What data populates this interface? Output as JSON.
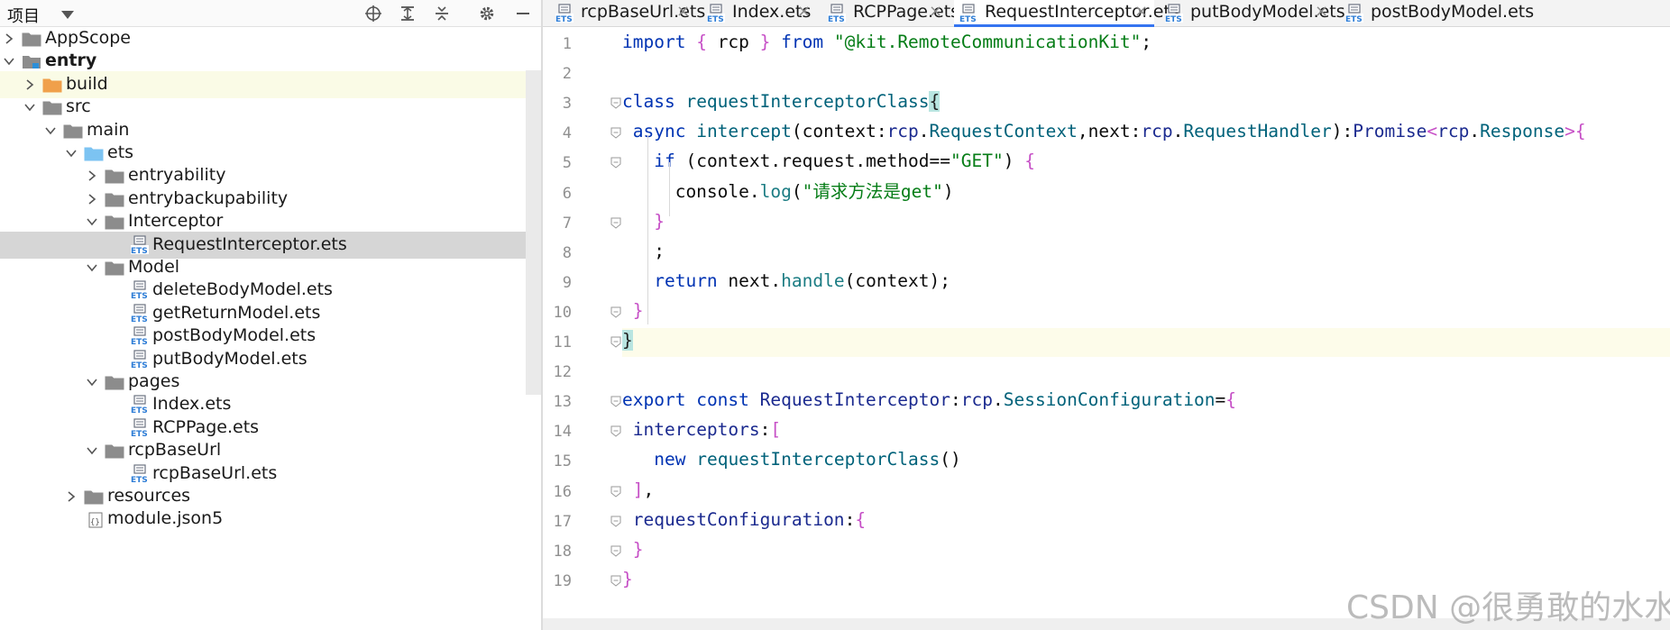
{
  "project_panel": {
    "title": "项目",
    "toolbar_icons": [
      "locate-icon",
      "expand-all-icon",
      "collapse-all-icon",
      "settings-icon",
      "minimize-icon"
    ],
    "tree": [
      {
        "label": "AppScope",
        "type": "folder",
        "depth": 0,
        "expanded": false
      },
      {
        "label": "entry",
        "type": "module",
        "depth": 0,
        "expanded": true,
        "bold": true
      },
      {
        "label": "build",
        "type": "folder-orange",
        "depth": 1,
        "expanded": false,
        "highlight": true
      },
      {
        "label": "src",
        "type": "folder",
        "depth": 1,
        "expanded": true
      },
      {
        "label": "main",
        "type": "folder",
        "depth": 2,
        "expanded": true
      },
      {
        "label": "ets",
        "type": "folder-blue",
        "depth": 3,
        "expanded": true
      },
      {
        "label": "entryability",
        "type": "folder",
        "depth": 4,
        "expanded": false
      },
      {
        "label": "entrybackupability",
        "type": "folder",
        "depth": 4,
        "expanded": false
      },
      {
        "label": "Interceptor",
        "type": "folder",
        "depth": 4,
        "expanded": true
      },
      {
        "label": "RequestInterceptor.ets",
        "type": "ets",
        "depth": 5,
        "selected": true
      },
      {
        "label": "Model",
        "type": "folder",
        "depth": 4,
        "expanded": true
      },
      {
        "label": "deleteBodyModel.ets",
        "type": "ets",
        "depth": 5
      },
      {
        "label": "getReturnModel.ets",
        "type": "ets",
        "depth": 5
      },
      {
        "label": "postBodyModel.ets",
        "type": "ets",
        "depth": 5
      },
      {
        "label": "putBodyModel.ets",
        "type": "ets",
        "depth": 5
      },
      {
        "label": "pages",
        "type": "folder",
        "depth": 4,
        "expanded": true
      },
      {
        "label": "Index.ets",
        "type": "ets",
        "depth": 5
      },
      {
        "label": "RCPPage.ets",
        "type": "ets",
        "depth": 5
      },
      {
        "label": "rcpBaseUrl",
        "type": "folder",
        "depth": 4,
        "expanded": true
      },
      {
        "label": "rcpBaseUrl.ets",
        "type": "ets",
        "depth": 5
      },
      {
        "label": "resources",
        "type": "folder",
        "depth": 3,
        "expanded": false
      },
      {
        "label": "module.json5",
        "type": "json",
        "depth": 3
      }
    ]
  },
  "editor": {
    "tabs": [
      {
        "label": "rcpBaseUrl.ets",
        "active": false
      },
      {
        "label": "Index.ets",
        "active": false
      },
      {
        "label": "RCPPage.ets",
        "active": false
      },
      {
        "label": "RequestInterceptor.ets",
        "active": true
      },
      {
        "label": "putBodyModel.ets",
        "active": false
      },
      {
        "label": "postBodyModel.ets",
        "active": false
      }
    ],
    "tab_close_glyph": "×",
    "current_line": 11,
    "lines": [
      {
        "no": "1",
        "tokens": [
          [
            "kw",
            "import"
          ],
          [
            "pl",
            " "
          ],
          [
            "br",
            "{"
          ],
          [
            "pl",
            " rcp "
          ],
          [
            "br",
            "}"
          ],
          [
            "pl",
            " "
          ],
          [
            "kw",
            "from"
          ],
          [
            "pl",
            " "
          ],
          [
            "str",
            "\"@kit.RemoteCommunicationKit\""
          ],
          [
            "pl",
            ";"
          ]
        ]
      },
      {
        "no": "2",
        "tokens": []
      },
      {
        "no": "3",
        "tokens": [
          [
            "kw",
            "class"
          ],
          [
            "pl",
            " "
          ],
          [
            "fn",
            "requestInterceptorClass"
          ],
          [
            "hlbr",
            "{"
          ]
        ]
      },
      {
        "no": "4",
        "tokens": [
          [
            "pl",
            " "
          ],
          [
            "kw",
            "async"
          ],
          [
            "pl",
            " "
          ],
          [
            "fn",
            "intercept"
          ],
          [
            "pl",
            "("
          ],
          [
            "pl",
            "context"
          ],
          [
            "pl",
            ":"
          ],
          [
            "id",
            "rcp"
          ],
          [
            "pl",
            "."
          ],
          [
            "fn",
            "RequestContext"
          ],
          [
            "pl",
            ","
          ],
          [
            "pl",
            "next"
          ],
          [
            "pl",
            ":"
          ],
          [
            "id",
            "rcp"
          ],
          [
            "pl",
            "."
          ],
          [
            "fn",
            "RequestHandler"
          ],
          [
            "pl",
            "):"
          ],
          [
            "id",
            "Promise"
          ],
          [
            "pn",
            "<"
          ],
          [
            "id",
            "rcp"
          ],
          [
            "pl",
            "."
          ],
          [
            "fn",
            "Response"
          ],
          [
            "pn",
            ">"
          ],
          [
            "br",
            "{"
          ]
        ]
      },
      {
        "no": "5",
        "tokens": [
          [
            "pl",
            "   "
          ],
          [
            "kw",
            "if"
          ],
          [
            "pl",
            " ("
          ],
          [
            "pl",
            "context"
          ],
          [
            "pl",
            "."
          ],
          [
            "pl",
            "request"
          ],
          [
            "pl",
            "."
          ],
          [
            "pl",
            "method"
          ],
          [
            "pl",
            "=="
          ],
          [
            "str",
            "\"GET\""
          ],
          [
            "pl",
            ") "
          ],
          [
            "br",
            "{"
          ]
        ]
      },
      {
        "no": "6",
        "tokens": [
          [
            "pl",
            "     console"
          ],
          [
            "pl",
            "."
          ],
          [
            "mth",
            "log"
          ],
          [
            "pl",
            "("
          ],
          [
            "str",
            "\"请求方法是get\""
          ],
          [
            "pl",
            ")"
          ]
        ]
      },
      {
        "no": "7",
        "tokens": [
          [
            "pl",
            "   "
          ],
          [
            "br",
            "}"
          ]
        ]
      },
      {
        "no": "8",
        "tokens": [
          [
            "pl",
            "   ;"
          ]
        ]
      },
      {
        "no": "9",
        "tokens": [
          [
            "pl",
            "   "
          ],
          [
            "kw",
            "return"
          ],
          [
            "pl",
            " next"
          ],
          [
            "pl",
            "."
          ],
          [
            "mth",
            "handle"
          ],
          [
            "pl",
            "(context);"
          ]
        ]
      },
      {
        "no": "10",
        "tokens": [
          [
            "pl",
            " "
          ],
          [
            "br",
            "}"
          ]
        ]
      },
      {
        "no": "11",
        "tokens": [
          [
            "hlbr",
            "}"
          ]
        ]
      },
      {
        "no": "12",
        "tokens": []
      },
      {
        "no": "13",
        "tokens": [
          [
            "kw",
            "export"
          ],
          [
            "pl",
            " "
          ],
          [
            "kw",
            "const"
          ],
          [
            "pl",
            " "
          ],
          [
            "id",
            "RequestInterceptor"
          ],
          [
            "pl",
            ":"
          ],
          [
            "id",
            "rcp"
          ],
          [
            "pl",
            "."
          ],
          [
            "fn",
            "SessionConfiguration"
          ],
          [
            "pl",
            "="
          ],
          [
            "br",
            "{"
          ]
        ]
      },
      {
        "no": "14",
        "tokens": [
          [
            "pl",
            " "
          ],
          [
            "id",
            "interceptors"
          ],
          [
            "pl",
            ":"
          ],
          [
            "br",
            "["
          ]
        ]
      },
      {
        "no": "15",
        "tokens": [
          [
            "pl",
            "   "
          ],
          [
            "kw",
            "new"
          ],
          [
            "pl",
            " "
          ],
          [
            "fn",
            "requestInterceptorClass"
          ],
          [
            "pl",
            "()"
          ]
        ]
      },
      {
        "no": "16",
        "tokens": [
          [
            "pl",
            " "
          ],
          [
            "br",
            "]"
          ],
          [
            "pl",
            ","
          ]
        ]
      },
      {
        "no": "17",
        "tokens": [
          [
            "pl",
            " "
          ],
          [
            "id",
            "requestConfiguration"
          ],
          [
            "pl",
            ":"
          ],
          [
            "br",
            "{"
          ]
        ]
      },
      {
        "no": "18",
        "tokens": [
          [
            "pl",
            " "
          ],
          [
            "br",
            "}"
          ]
        ]
      },
      {
        "no": "19",
        "tokens": [
          [
            "br",
            "}"
          ]
        ]
      }
    ]
  },
  "watermark": "CSDN @很勇敢的水水"
}
